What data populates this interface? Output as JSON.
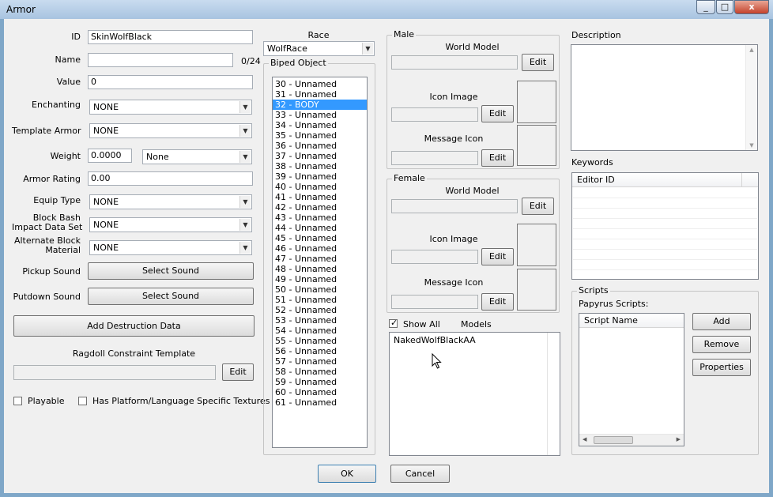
{
  "window": {
    "title": "Armor",
    "minimize": "_",
    "maximize": "□",
    "close": "x"
  },
  "left": {
    "id_label": "ID",
    "id_value": "SkinWolfBlack",
    "name_label": "Name",
    "name_value": "",
    "name_count": "0/24",
    "value_label": "Value",
    "value_value": "0",
    "enchanting_label": "Enchanting",
    "enchanting_value": "NONE",
    "template_label": "Template Armor",
    "template_value": "NONE",
    "weight_label": "Weight",
    "weight_value": "0.0000",
    "weight_type": "None",
    "armor_rating_label": "Armor Rating",
    "armor_rating_value": "0.00",
    "equip_type_label": "Equip Type",
    "equip_type_value": "NONE",
    "block_bash_label_1": "Block Bash",
    "block_bash_label_2": "Impact Data Set",
    "block_bash_value": "NONE",
    "alt_block_label_1": "Alternate Block",
    "alt_block_label_2": "Material",
    "alt_block_value": "NONE",
    "pickup_label": "Pickup Sound",
    "pickup_button": "Select Sound",
    "putdown_label": "Putdown Sound",
    "putdown_button": "Select Sound",
    "add_destruction": "Add Destruction Data",
    "ragdoll_label": "Ragdoll Constraint Template",
    "ragdoll_value": "",
    "ragdoll_edit": "Edit",
    "playable_label": "Playable",
    "platform_label": "Has Platform/Language Specific Textures"
  },
  "race": {
    "label": "Race",
    "value": "WolfRace",
    "biped_label": "Biped Object",
    "biped_items": [
      "30 - Unnamed",
      "31 - Unnamed",
      "32 - BODY",
      "33 - Unnamed",
      "34 - Unnamed",
      "35 - Unnamed",
      "36 - Unnamed",
      "37 - Unnamed",
      "38 - Unnamed",
      "39 - Unnamed",
      "40 - Unnamed",
      "41 - Unnamed",
      "42 - Unnamed",
      "43 - Unnamed",
      "44 - Unnamed",
      "45 - Unnamed",
      "46 - Unnamed",
      "47 - Unnamed",
      "48 - Unnamed",
      "49 - Unnamed",
      "50 - Unnamed",
      "51 - Unnamed",
      "52 - Unnamed",
      "53 - Unnamed",
      "54 - Unnamed",
      "55 - Unnamed",
      "56 - Unnamed",
      "57 - Unnamed",
      "58 - Unnamed",
      "59 - Unnamed",
      "60 - Unnamed",
      "61 - Unnamed"
    ],
    "selected_index": 2
  },
  "male": {
    "label": "Male",
    "world_model": "World Model",
    "icon_image": "Icon Image",
    "message_icon": "Message Icon",
    "edit": "Edit"
  },
  "female": {
    "label": "Female",
    "world_model": "World Model",
    "icon_image": "Icon Image",
    "message_icon": "Message Icon",
    "edit": "Edit"
  },
  "models": {
    "show_all": "Show All",
    "label": "Models",
    "items": [
      "NakedWolfBlackAA"
    ]
  },
  "right": {
    "description_label": "Description",
    "description_value": "",
    "keywords_label": "Keywords",
    "keywords_column": "Editor ID",
    "scripts_label": "Scripts",
    "papyrus_label": "Papyrus Scripts:",
    "script_column": "Script Name",
    "add": "Add",
    "remove": "Remove",
    "properties": "Properties"
  },
  "footer": {
    "ok": "OK",
    "cancel": "Cancel"
  }
}
